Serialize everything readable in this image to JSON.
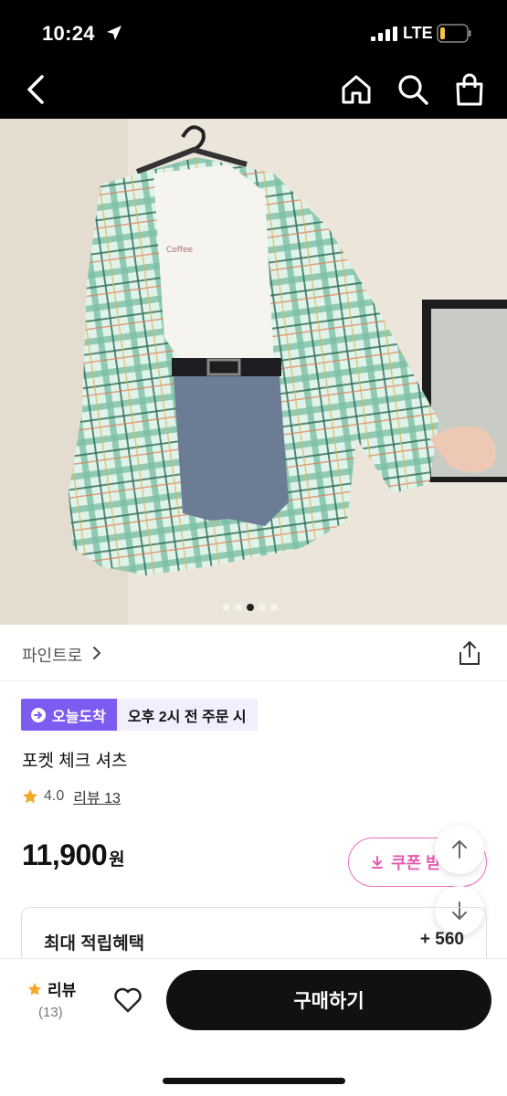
{
  "status_bar": {
    "time": "10:24",
    "network": "LTE"
  },
  "header": {
    "back_icon": "chevron-left-icon",
    "home_icon": "home-icon",
    "search_icon": "search-icon",
    "cart_icon": "shopping-bag-icon"
  },
  "gallery": {
    "slide_count": 5,
    "active_index": 2
  },
  "brand": {
    "name": "파인트로"
  },
  "delivery": {
    "badge_label": "오늘도착",
    "condition": "오후 2시 전 주문 시"
  },
  "product": {
    "title": "포켓 체크 셔츠",
    "rating": "4.0",
    "review_link": "리뷰 13",
    "price": "11,900",
    "currency": "원"
  },
  "coupon": {
    "label": "쿠폰 받"
  },
  "reward": {
    "label": "최대 적립혜택",
    "value": "+ 560"
  },
  "bottom_bar": {
    "review_label": "리뷰",
    "review_count": "(13)",
    "buy_label": "구매하기"
  },
  "colors": {
    "accent_purple": "#7c5cf0",
    "coupon_pink": "#e75ab0",
    "star": "#f5a623",
    "black": "#111111"
  }
}
